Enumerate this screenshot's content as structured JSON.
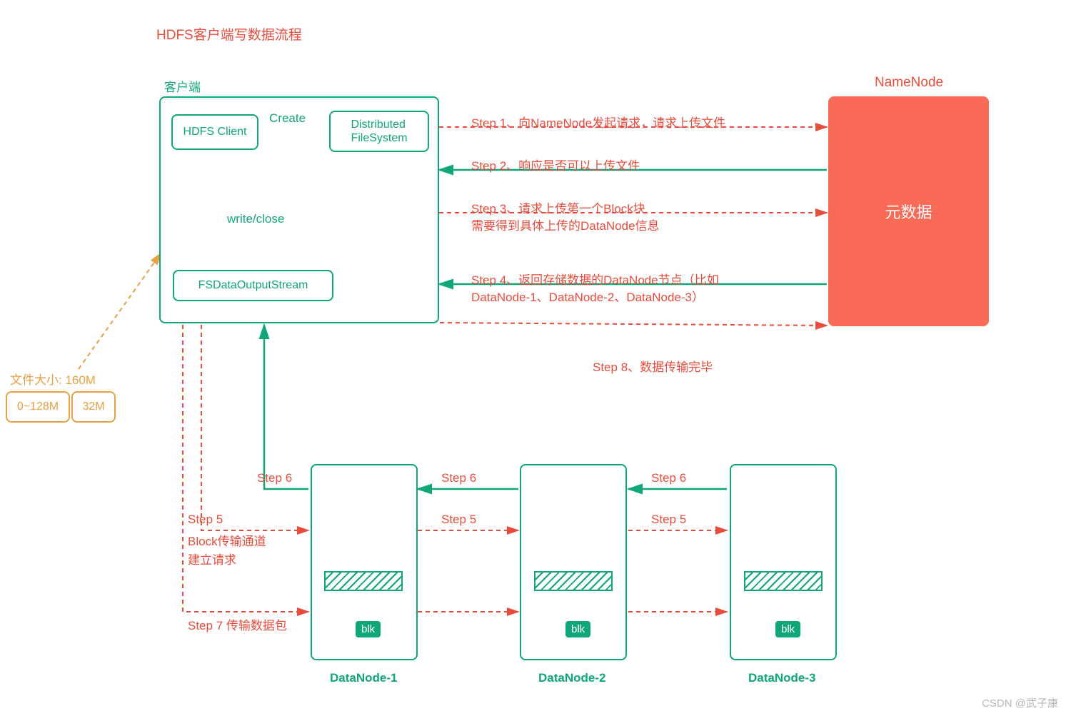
{
  "title": "HDFS客户端写数据流程",
  "client_section_label": "客户端",
  "client_box_hdfs": "HDFS Client",
  "client_create_label": "Create",
  "distributed_fs": "Distributed\nFileSystem",
  "write_close": "write/close",
  "fs_stream": "FSDataOutputStream",
  "file_size_label": "文件大小: 160M",
  "file_block_1": "0~128M",
  "file_block_2": "32M",
  "namenode_label": "NameNode",
  "namenode_content": "元数据",
  "step1": "Step 1、向NameNode发起请求，请求上传文件",
  "step2": "Step 2、响应是否可以上传文件",
  "step3_line1": "Step 3、请求上传第一个Block块",
  "step3_line2": "需要得到具体上传的DataNode信息",
  "step4_line1": "Step 4、返回存储数据的DataNode节点（比如",
  "step4_line2": "DataNode-1、DataNode-2、DataNode-3）",
  "step5_label_a": "Step 5",
  "step5_label_b": "Block传输通道",
  "step5_label_c": "建立请求",
  "inter_step5": "Step 5",
  "inter_step6": "Step 6",
  "top_step6": "Step 6",
  "step7": "Step 7 传输数据包",
  "step8": "Step 8、数据传输完毕",
  "datanode1": "DataNode-1",
  "datanode2": "DataNode-2",
  "datanode3": "DataNode-3",
  "blk": "blk",
  "watermark": "CSDN @武子康",
  "colors": {
    "teal": "#0fa67a",
    "red": "#e74c3c",
    "orange": "#e8a040",
    "salmon": "#f96a57"
  }
}
